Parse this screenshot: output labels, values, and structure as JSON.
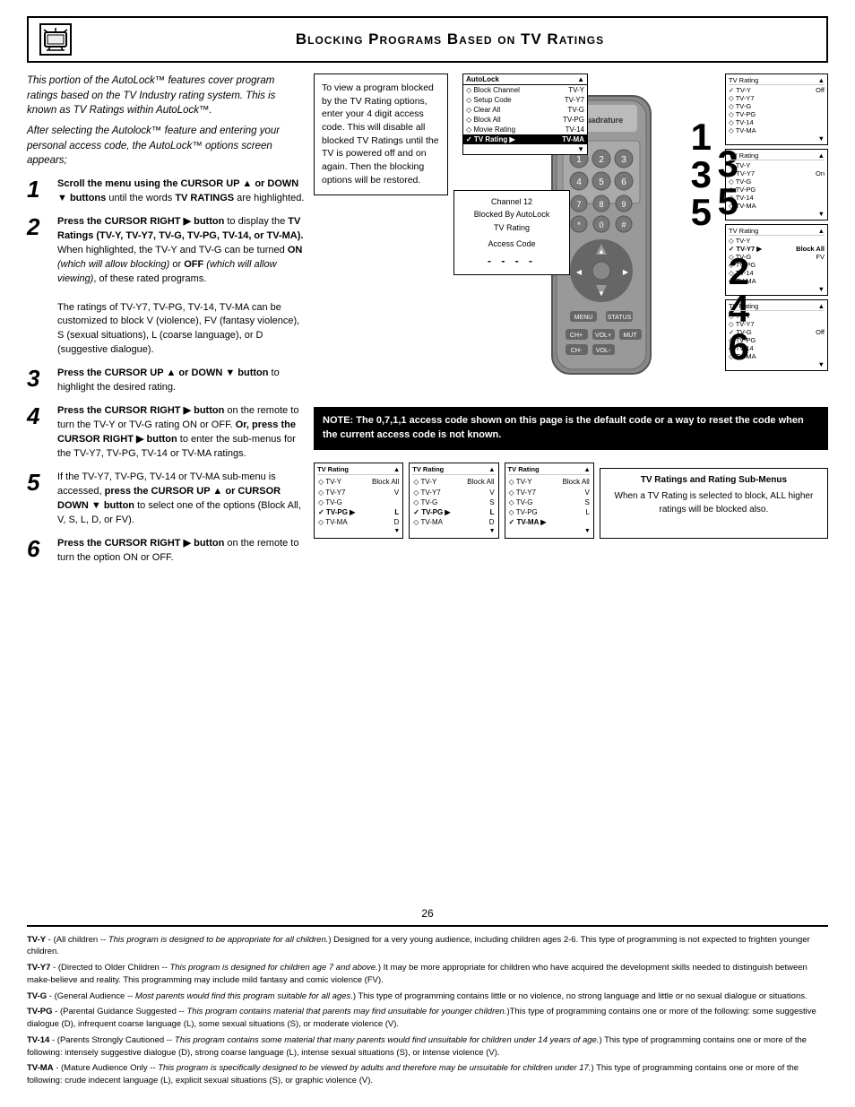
{
  "page": {
    "title": "Blocking Programs Based on TV Ratings",
    "page_number": "26"
  },
  "intro": {
    "p1": "This portion of the AutoLock™ features cover program ratings based on the TV Industry rating system. This is known as TV Ratings within AutoLock™.",
    "p2": "After selecting the Autolock™ feature and entering your personal access code, the AutoLock™ options screen appears;"
  },
  "steps": [
    {
      "num": "1",
      "html": "<b>Scroll the menu using the CURSOR UP ▲ or DOWN ▼ buttons</b> until the words <b>TV RATINGS</b> are highlighted."
    },
    {
      "num": "2",
      "html": "<b>Press the CURSOR RIGHT ▶ button</b> to display the <b>TV Ratings (TV-Y, TV-Y7, TV-G, TV-PG, TV-14, or TV-MA).</b> When highlighted, the TV-Y and TV-G can be turned <b>ON</b> <i>(which will allow blocking)</i> or <b>OFF</b> <i>(which will allow viewing)</i>, of these rated programs.<br><br>The ratings of TV-Y7, TV-PG, TV-14, TV-MA can be customized to block V (violence), FV (fantasy violence), S (sexual situations), L (coarse language), or D (suggestive dialogue)."
    },
    {
      "num": "3",
      "html": "<b>Press the CURSOR UP ▲ or DOWN ▼ button</b> to highlight the desired rating."
    },
    {
      "num": "4",
      "html": "<b>Press the CURSOR RIGHT ▶ button</b> on the remote to turn the TV-Y or TV-G rating ON or OFF. <b>Or, press the CURSOR RIGHT ▶ button</b> to enter the sub-menus for the TV-Y7, TV-PG, TV-14 or TV-MA ratings."
    },
    {
      "num": "5",
      "html": "If the TV-Y7, TV-PG, TV-14 or TV-MA sub-menu is accessed, <b>press the CURSOR UP ▲ or CURSOR DOWN ▼ button</b> to select one of the options (Block All, V, S, L, D, or FV)."
    },
    {
      "num": "6",
      "html": "<b>Press the CURSOR RIGHT ▶ button</b> on the remote to turn the option ON or OFF."
    }
  ],
  "instruction_box": {
    "text": "To view a program blocked by the TV Rating options, enter your 4 digit access code. This will disable all blocked TV Ratings until the TV is powered off and on again. Then the blocking options will be restored."
  },
  "autolock_menu": {
    "header": "AutoLock",
    "items": [
      {
        "label": "Block Channel",
        "value": "TV-Y"
      },
      {
        "label": "Setup Code",
        "value": "TV-Y7"
      },
      {
        "label": "Clear All",
        "value": "TV-G"
      },
      {
        "label": "Block All",
        "value": "TV-PG"
      },
      {
        "label": "Movie Rating",
        "value": "TV-14"
      },
      {
        "label": "TV Rating",
        "value": "TV-MA",
        "highlighted": true
      }
    ]
  },
  "channel_blocked": {
    "line1": "Channel 12",
    "line2": "Blocked By AutoLock",
    "line3": "TV Rating",
    "label": "Access Code",
    "code": "- - - -"
  },
  "note": "NOTE: The 0,7,1,1 access code shown on this page is the default code or a way to reset the code when the current access code is not known.",
  "rating_panels_right": [
    {
      "header": "TV Rating",
      "arrow": "▲",
      "rows": [
        {
          "check": "✓",
          "label": "TV-Y",
          "value": "Off",
          "diamond": false
        },
        {
          "check": "◇",
          "label": "TV-Y7",
          "value": "",
          "diamond": true
        },
        {
          "check": "◇",
          "label": "TV-G",
          "value": "",
          "diamond": true
        },
        {
          "check": "◇",
          "label": "TV-PG",
          "value": "",
          "diamond": true
        },
        {
          "check": "◇",
          "label": "TV-14",
          "value": "",
          "diamond": true
        },
        {
          "check": "◇",
          "label": "TV-MA",
          "value": "",
          "diamond": true
        }
      ]
    },
    {
      "header": "TV Rating",
      "arrow": "▲",
      "rows": [
        {
          "check": "◇",
          "label": "TV-Y",
          "value": "",
          "diamond": true
        },
        {
          "check": "✓",
          "label": "TV-Y7",
          "value": "On",
          "diamond": false
        },
        {
          "check": "◇",
          "label": "TV-G",
          "value": "",
          "diamond": true
        },
        {
          "check": "◇",
          "label": "TV-PG",
          "value": "",
          "diamond": true
        },
        {
          "check": "◇",
          "label": "TV-14",
          "value": "",
          "diamond": true
        },
        {
          "check": "◇",
          "label": "TV-MA",
          "value": "",
          "diamond": true
        }
      ]
    },
    {
      "header": "TV Rating",
      "arrow": "▲",
      "rows": [
        {
          "check": "◇",
          "label": "TV-Y",
          "value": "",
          "diamond": true
        },
        {
          "check": "✓",
          "label": "TV-Y7",
          "value": "Block All",
          "arrow": "▶",
          "diamond": false
        },
        {
          "check": "◇",
          "label": "TV-G",
          "value": "FV",
          "diamond": true
        },
        {
          "check": "◇",
          "label": "TV-PG",
          "value": "",
          "diamond": true
        },
        {
          "check": "◇",
          "label": "TV-14",
          "value": "",
          "diamond": true
        },
        {
          "check": "◇",
          "label": "TV-MA",
          "value": "",
          "diamond": true
        }
      ]
    },
    {
      "header": "TV Rating",
      "arrow": "▲",
      "rows": [
        {
          "check": "◇",
          "label": "TV-Y",
          "value": "",
          "diamond": true
        },
        {
          "check": "◇",
          "label": "TV-Y7",
          "value": "",
          "diamond": true
        },
        {
          "check": "✓",
          "label": "TV-G",
          "value": "Off",
          "diamond": false
        },
        {
          "check": "◇",
          "label": "TV-PG",
          "value": "",
          "diamond": true
        },
        {
          "check": "◇",
          "label": "TV-14",
          "value": "",
          "diamond": true
        },
        {
          "check": "◇",
          "label": "TV-MA",
          "value": "",
          "diamond": true
        }
      ]
    }
  ],
  "bottom_rating_panels": [
    {
      "header": "TV Rating",
      "arrow": "▲",
      "rows": [
        {
          "label": "◇ TV-Y",
          "value": "Block All"
        },
        {
          "label": "◇ TV-Y7",
          "value": "V"
        },
        {
          "label": "◇ TV-G",
          "value": ""
        },
        {
          "label": "✓ TV-PG ▶",
          "value": "L"
        },
        {
          "label": "◇ TV-MA",
          "value": "D"
        }
      ]
    },
    {
      "header": "TV Rating",
      "arrow": "▲",
      "rows": [
        {
          "label": "◇ TV-Y",
          "value": "Block All"
        },
        {
          "label": "◇ TV-Y7",
          "value": "V"
        },
        {
          "label": "◇ TV-G",
          "value": "S"
        },
        {
          "label": "✓ TV-PG ▶",
          "value": "L"
        },
        {
          "label": "◇ TV-MA",
          "value": "D"
        }
      ]
    },
    {
      "header": "TV Rating",
      "arrow": "▲",
      "rows": [
        {
          "label": "◇ TV-Y",
          "value": "Block All"
        },
        {
          "label": "◇ TV-Y7",
          "value": "V"
        },
        {
          "label": "◇ TV-G",
          "value": "S"
        },
        {
          "label": "◇ TV-PG",
          "value": "L"
        },
        {
          "label": "✓ TV-MA ▶",
          "value": ""
        }
      ]
    }
  ],
  "tv_ratings_caption": {
    "title": "TV Ratings and Rating Sub-Menus",
    "desc": "When a TV Rating is selected to block, ALL higher ratings will be blocked also."
  },
  "footer": {
    "entries": [
      {
        "term": "TV-Y",
        "def": " - (All children -- This program is designed to be appropriate for all children.) Designed for a very young audience, including children ages 2-6. This type of programming is not expected to frighten younger children."
      },
      {
        "term": "TV-Y7",
        "def": " - (Directed to Older Children -- This program is designed for children age 7 and above.) It may be more appropriate for children who have acquired the development skills needed to distinguish between make-believe and reality. This programming may include mild fantasy and comic violence (FV)."
      },
      {
        "term": "TV-G",
        "def": " - (General Audience -- Most parents would find this program suitable for all ages.) This type of programming contains little or no violence, no strong language and little or no sexual dialogue or situations."
      },
      {
        "term": "TV-PG",
        "def": " - (Parental Guidance Suggested -- This program contains material that parents may find unsuitable for younger children.) This type of programming contains one or more of the following: some suggestive dialogue (D), infrequent coarse language (L), some sexual situations (S), or moderate violence (V)."
      },
      {
        "term": "TV-14",
        "def": " - (Parents Strongly Cautioned -- This program contains some material that many parents would find unsuitable for children under 14 years of age.) This type of programming contains one or more of the following: intensely suggestive dialogue (D), strong coarse language (L), intense sexual situations (S), or intense violence (V)."
      },
      {
        "term": "TV-MA",
        "def": " - (Mature Audience Only -- This program is specifically designed to be viewed by adults and therefore may be unsuitable for children under 17.) This type of programming contains one or more of the following: crude indecent language (L), explicit sexual situations (S), or graphic violence (V)."
      }
    ]
  }
}
